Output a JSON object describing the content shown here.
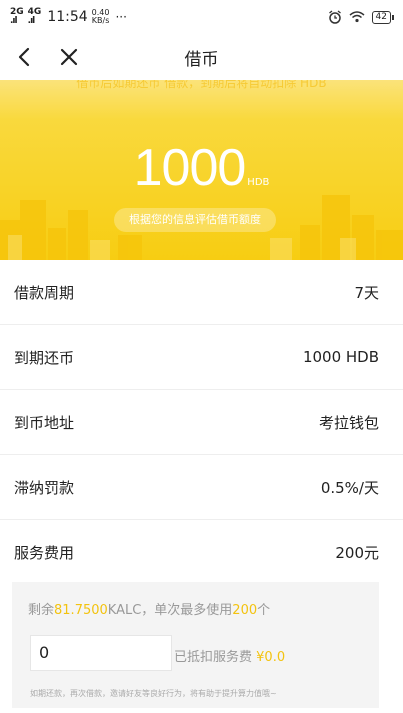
{
  "status_bar": {
    "signal_1": "2G",
    "signal_2": "4G",
    "time": "11:54",
    "speed_value": "0.40",
    "speed_unit": "KB/s",
    "more": "···",
    "battery": "42",
    "icons": [
      "signal-icon",
      "alarm-icon",
      "wifi-icon",
      "battery-icon"
    ]
  },
  "nav": {
    "title": "借币",
    "back_icon": "chevron-left-icon",
    "close_icon": "close-icon"
  },
  "hero": {
    "notice": "借币后如期还币 借款，到期后将自动扣除 HDB",
    "amount": "1000",
    "unit": "HDB",
    "subtitle": "根据您的信息评估借币额度",
    "accent_color": "#f7cd12"
  },
  "details": [
    {
      "label": "借款周期",
      "value": "7天"
    },
    {
      "label": "到期还币",
      "value": "1000 HDB"
    },
    {
      "label": "到币地址",
      "value": "考拉钱包"
    },
    {
      "label": "滞纳罚款",
      "value": "0.5%/天"
    },
    {
      "label": "服务费用",
      "value": "200元"
    }
  ],
  "deduction": {
    "remain_prefix": "剩余",
    "remain_amount": "81.7500",
    "remain_mid": "KALC，单次最多使用",
    "max_use": "200",
    "remain_suffix": "个",
    "input_value": "0",
    "deducted_label": "已抵扣服务费",
    "deducted_amount": "¥0.0",
    "note": "如期还款，再次借款，邀请好友等良好行为，将有助于提升算力值哦~"
  }
}
